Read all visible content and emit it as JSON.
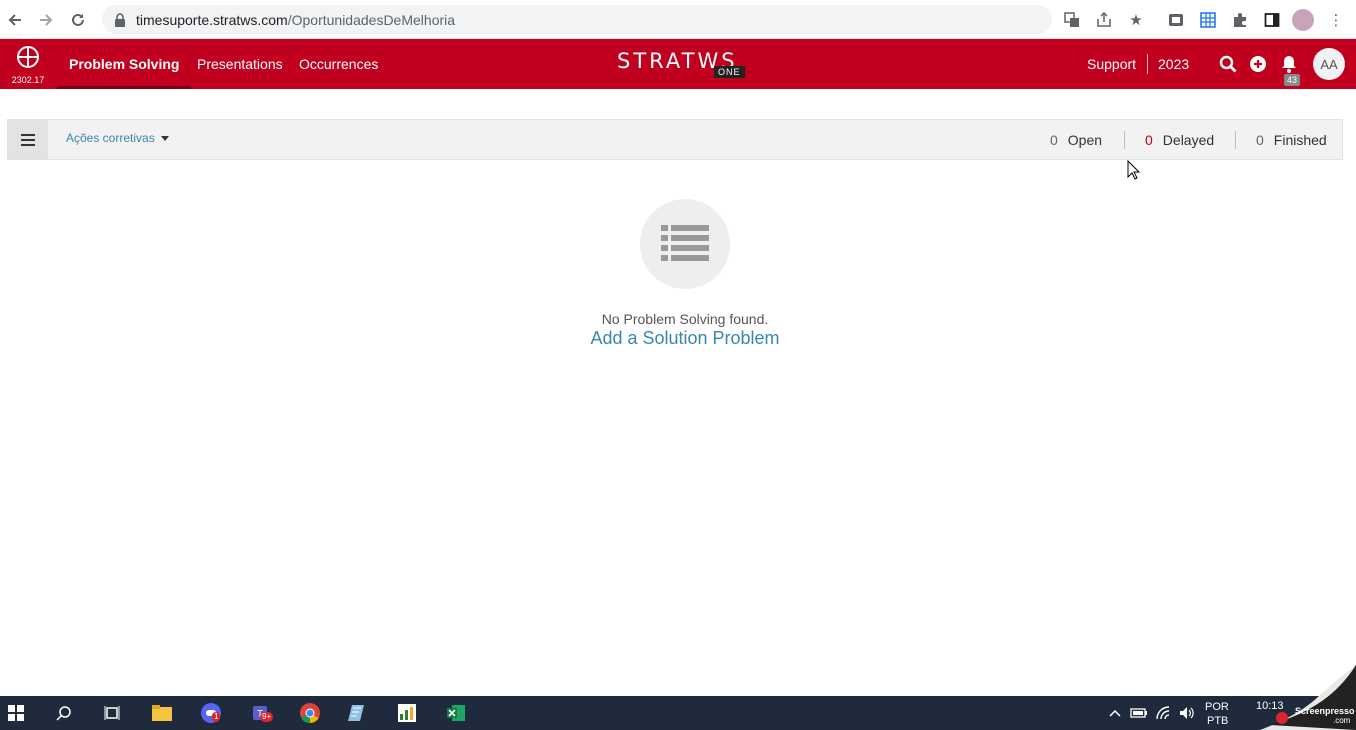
{
  "browser": {
    "url_host": "timesuporte.stratws.com",
    "url_path": "/OportunidadesDeMelhoria"
  },
  "header": {
    "version": "2302.17",
    "nav": [
      "Problem Solving",
      "Presentations",
      "Occurrences"
    ],
    "brand": "STRATWS",
    "brand_suffix": "ONE",
    "support_label": "Support",
    "year": "2023",
    "notification_count": "43",
    "avatar_initials": "AA",
    "accent_color": "#c0001e"
  },
  "toolbar": {
    "filter_label": "Ações corretivas",
    "stats": [
      {
        "count": "0",
        "label": "Open"
      },
      {
        "count": "0",
        "label": "Delayed"
      },
      {
        "count": "0",
        "label": "Finished"
      }
    ]
  },
  "empty_state": {
    "message": "No Problem Solving found.",
    "action": "Add a Solution Problem"
  },
  "taskbar": {
    "teams_badge": "9+",
    "discord_badge": "1",
    "lang_top": "POR",
    "lang_bottom": "PTB",
    "time": "10:13",
    "screenpresso_label": "Screenpresso",
    "screenpresso_suffix": ".com"
  }
}
